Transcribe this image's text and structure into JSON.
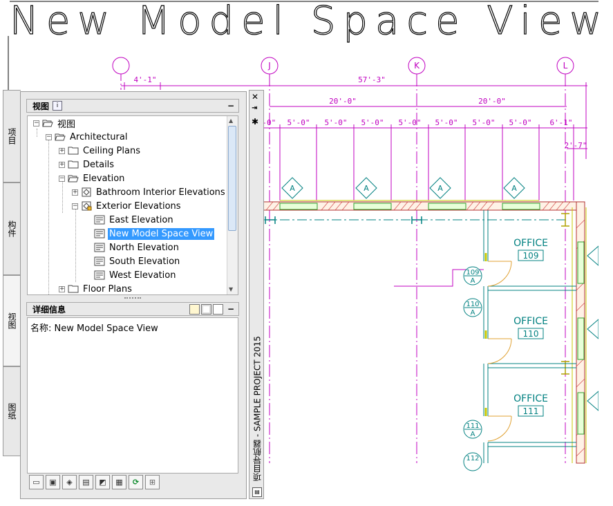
{
  "drawing": {
    "title": "New Model Space View",
    "grids": [
      "J",
      "K",
      "L"
    ],
    "dims": {
      "d1": "4'-1\"",
      "d2": "57'-3\"",
      "d3": "20'-0\"",
      "d4": "20'-0\"",
      "d5": "5'-0\"",
      "d6": "2'-7\"",
      "d7": "6'-1\"",
      "d8": "'-0\""
    },
    "tag": "A",
    "rooms": [
      {
        "name": "OFFICE",
        "num": "109"
      },
      {
        "name": "OFFICE",
        "num": "110"
      },
      {
        "name": "OFFICE",
        "num": "111"
      }
    ],
    "doors": [
      {
        "num": "109",
        "sub": "A"
      },
      {
        "num": "110",
        "sub": "A"
      },
      {
        "num": "111",
        "sub": "A"
      },
      {
        "num": "112",
        "sub": ""
      }
    ]
  },
  "palette": {
    "tabs": [
      "项目",
      "构件",
      "视图",
      "图纸"
    ],
    "views_header": "视图",
    "details_header": "详细信息",
    "detail_text": "名称: New Model Space View",
    "vertical_title": "项目导航器 - SAMPLE PROJECT 2015",
    "tree": [
      {
        "label": "视图",
        "icon": "folder-open-icon",
        "level": 0
      },
      {
        "label": "Architectural",
        "icon": "folder-open-icon",
        "level": 1
      },
      {
        "label": "Ceiling Plans",
        "icon": "folder-icon",
        "level": 2
      },
      {
        "label": "Details",
        "icon": "folder-icon",
        "level": 2
      },
      {
        "label": "Elevation",
        "icon": "folder-open-icon",
        "level": 2
      },
      {
        "label": "Bathroom Interior Elevations",
        "icon": "view-drawing-icon",
        "level": 3
      },
      {
        "label": "Exterior Elevations",
        "icon": "view-drawing-lock-icon",
        "level": 3
      },
      {
        "label": "East Elevation",
        "icon": "view-icon",
        "level": 4
      },
      {
        "label": "New Model Space View",
        "icon": "view-icon",
        "level": 4,
        "selected": true
      },
      {
        "label": "North Elevation",
        "icon": "view-icon",
        "level": 4
      },
      {
        "label": "South Elevation",
        "icon": "view-icon",
        "level": 4
      },
      {
        "label": "West Elevation",
        "icon": "view-icon",
        "level": 4
      },
      {
        "label": "Floor Plans",
        "icon": "folder-icon",
        "level": 2
      }
    ]
  }
}
